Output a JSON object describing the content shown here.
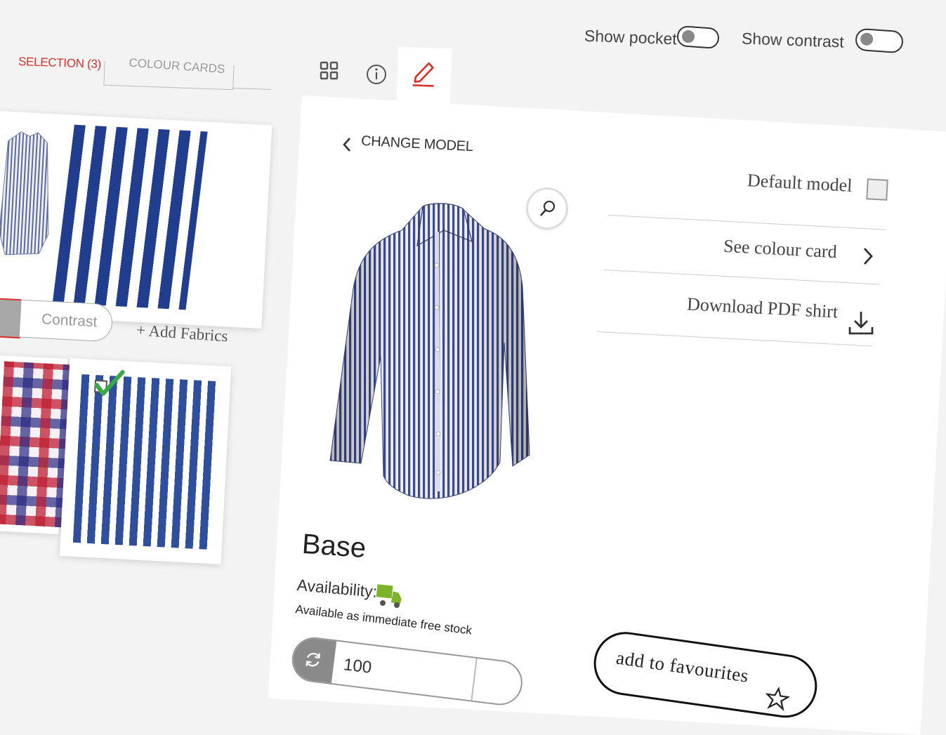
{
  "toggles": {
    "show_pocket_label": "Show pocket",
    "show_contrast_label": "Show contrast"
  },
  "left_tabs": {
    "selection_label": "SELECTION (3)",
    "colour_cards_label": "COLOUR CARDS"
  },
  "fabrics": {
    "contrast_label": "Contrast",
    "add_fabrics_label": "+ Add Fabrics"
  },
  "panel": {
    "change_model_label": "CHANGE MODEL",
    "options": {
      "default_model_label": "Default model",
      "see_colour_card_label": "See colour card",
      "download_pdf_label": "Download PDF shirt"
    },
    "product": {
      "name": "Base",
      "availability_label": "Availability:",
      "availability_text": "Available as immediate free stock"
    },
    "quantity_value": "100",
    "favourites_label": "add to favourites"
  },
  "colors": {
    "accent": "#d8302a",
    "success": "#3aa845",
    "truck": "#7cb32a"
  },
  "icons": {
    "grid": "grid-icon",
    "info": "info-icon",
    "edit": "pencil-icon",
    "zoom": "magnifier-icon",
    "back": "chevron-left-icon",
    "forward": "chevron-right-icon",
    "download": "download-icon",
    "refresh": "refresh-icon",
    "star": "star-icon",
    "truck": "truck-icon",
    "check": "check-icon"
  }
}
